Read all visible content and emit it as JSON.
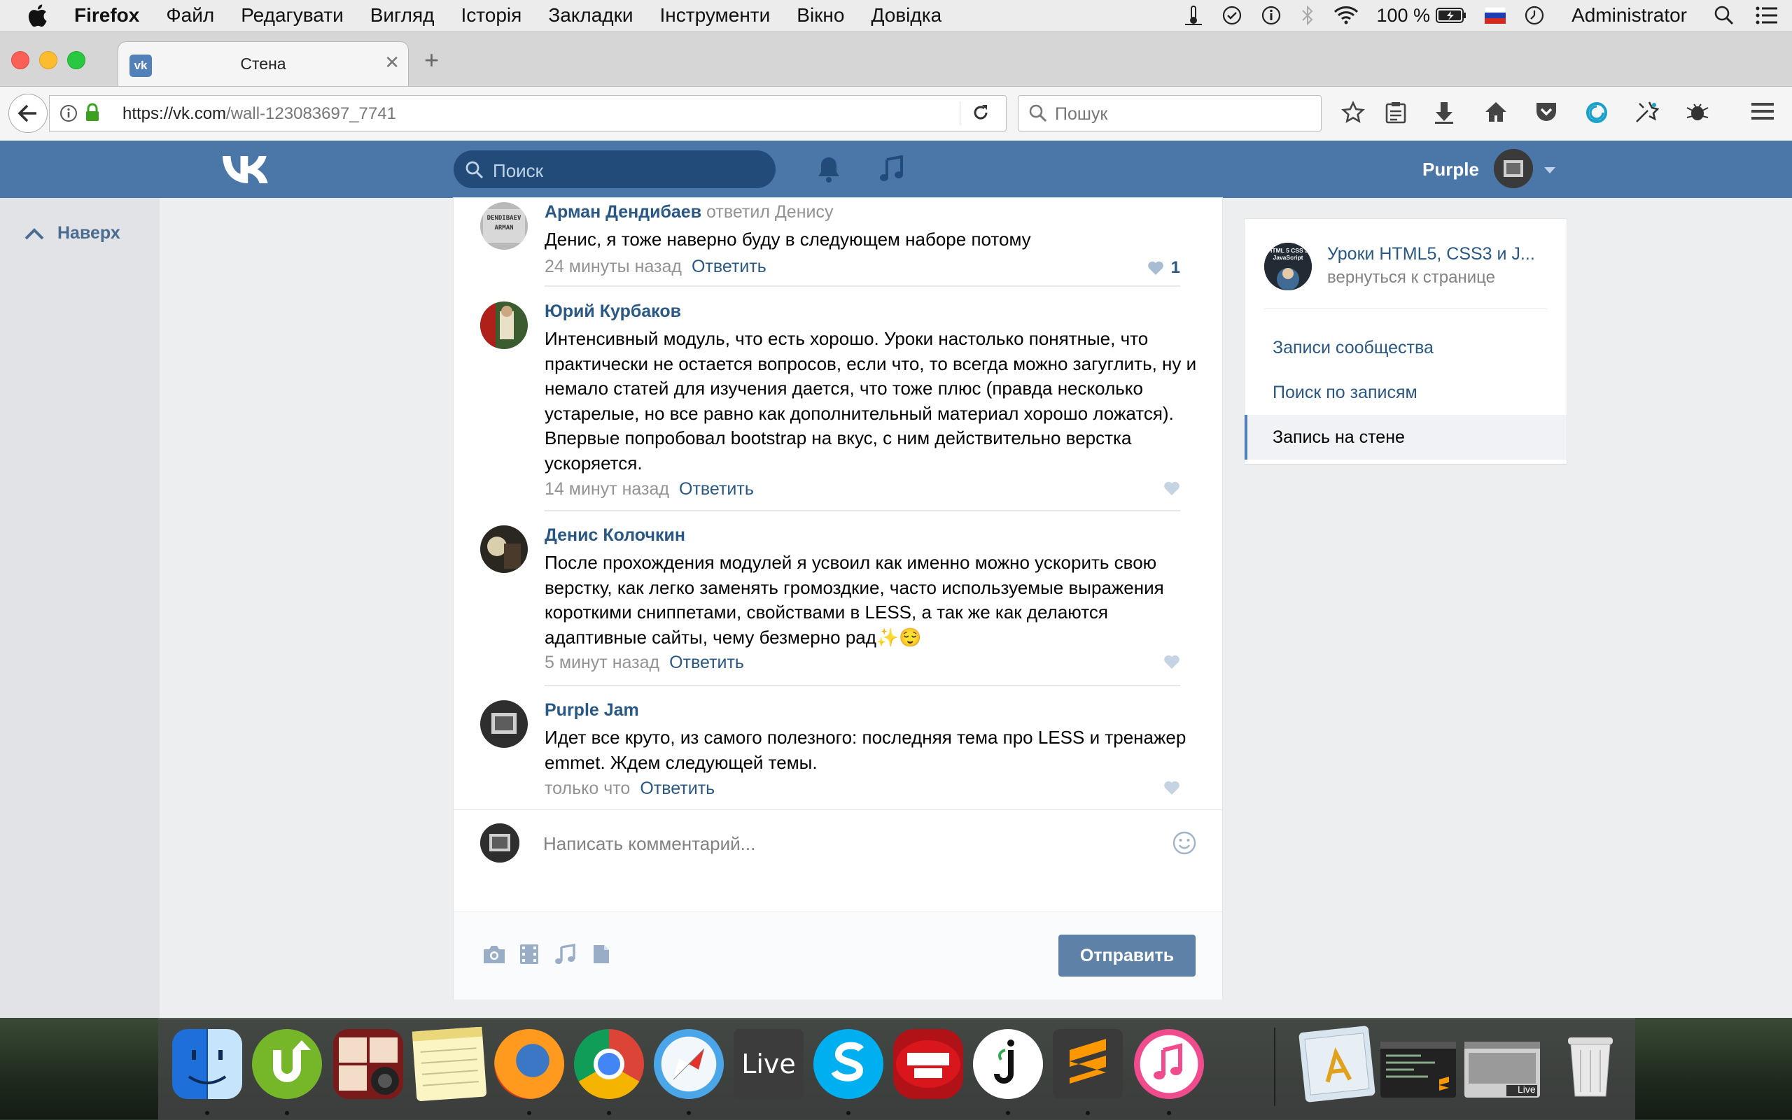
{
  "menubar": {
    "app": "Firefox",
    "items": [
      "Файл",
      "Редагувати",
      "Вигляд",
      "Історія",
      "Закладки",
      "Інструменти",
      "Вікно",
      "Довідка"
    ],
    "battery": "100 %",
    "user": "Administrator"
  },
  "browser": {
    "tab_title": "Стена",
    "url_host": "https://vk.com",
    "url_path": "/wall-123083697_7741",
    "search_placeholder": "Пошук"
  },
  "vk_header": {
    "search_placeholder": "Поиск",
    "username": "Purple"
  },
  "left": {
    "up_label": "Наверх"
  },
  "comments": [
    {
      "author": "Арман Дендибаев",
      "reply_to": "ответил Денису",
      "text": "Денис, я тоже наверно буду в следующем наборе потому",
      "time": "24 минуты назад",
      "reply": "Ответить",
      "likes": "1"
    },
    {
      "author": "Юрий Курбаков",
      "reply_to": "",
      "text": "Интенсивный модуль, что есть хорошо. Уроки настолько понятные, что практически не остается вопросов, если что, то всегда можно загуглить, ну и немало статей для изучения дается, что тоже плюс (правда несколько устарелые, но все равно как дополнительный материал хорошо ложатся). Впервые попробовал bootstrap на вкус, с ним действительно верстка ускоряется.",
      "time": "14 минут назад",
      "reply": "Ответить",
      "likes": ""
    },
    {
      "author": "Денис Колочкин",
      "reply_to": "",
      "text": "После прохождения модулей я усвоил как именно можно ускорить свою верстку, как легко заменять громоздкие, часто используемые выражения короткими сниппетами, свойствами в LESS, а так же как делаются адаптивные сайты, чему безмерно рад✨😌",
      "time": "5 минут назад",
      "reply": "Ответить",
      "likes": ""
    },
    {
      "author": "Purple Jam",
      "reply_to": "",
      "text": "Идет все круто, из самого полезного: последняя тема про LESS и тренажер emmet. Ждем следующей темы.",
      "time": "только что",
      "reply": "Ответить",
      "likes": ""
    }
  ],
  "composer": {
    "placeholder": "Написать комментарий...",
    "send": "Отправить"
  },
  "sidebar": {
    "group_title": "Уроки HTML5, CSS3 и J...",
    "back": "вернуться к странице",
    "items": [
      "Записи сообщества",
      "Поиск по записям",
      "Запись на стене"
    ]
  },
  "avatar_texts": {
    "arman": "DENDIBAEV ARMAN",
    "group": "HTML 5 CSS 3 JavaScript"
  },
  "dock": {
    "live_label": "Live",
    "items": [
      "finder-icon",
      "utorrent-icon",
      "photo-booth-icon",
      "notes-icon",
      "firefox-icon",
      "chrome-icon",
      "safari-icon",
      "ableton-live-icon",
      "skype-icon",
      "pod-farm-icon",
      "jumpcut-icon",
      "sublime-text-icon",
      "itunes-icon",
      "applications-folder-icon",
      "terminal-window-icon",
      "live-window-icon",
      "trash-icon"
    ]
  },
  "colors": {
    "vk_header": "#4a76a8",
    "vk_link": "#2a5885",
    "send_button": "#5e81a8"
  }
}
